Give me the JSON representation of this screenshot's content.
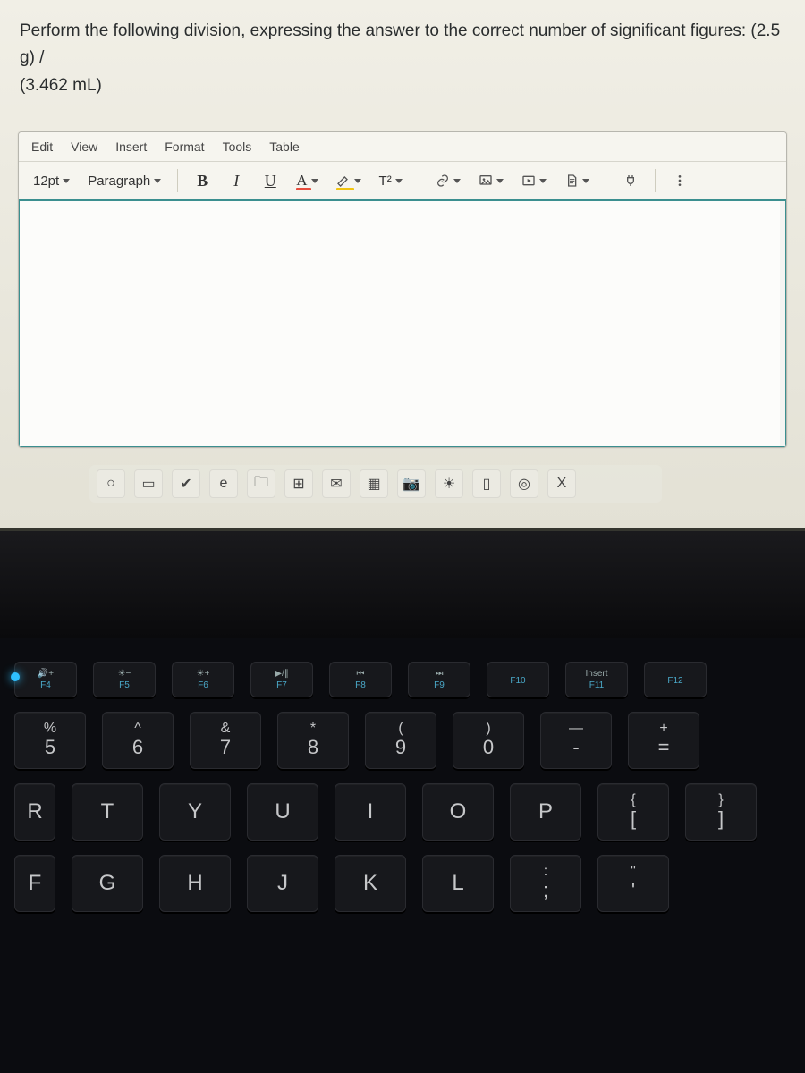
{
  "question": {
    "line1": "Perform the following division, expressing the answer to the correct number of significant figures: (2.5 g) /",
    "line2": "(3.462 mL)"
  },
  "menubar": {
    "edit": "Edit",
    "view": "View",
    "insert": "Insert",
    "format": "Format",
    "tools": "Tools",
    "table": "Table"
  },
  "toolbar": {
    "font_size": "12pt",
    "block": "Paragraph",
    "bold": "B",
    "italic": "I",
    "underline": "U",
    "textcolor": "A",
    "superscript": "T²"
  },
  "taskbar": {
    "items": [
      {
        "name": "search-icon",
        "glyph": "○"
      },
      {
        "name": "taskview-icon",
        "glyph": "▭"
      },
      {
        "name": "check-icon",
        "glyph": "✔"
      },
      {
        "name": "edge-icon",
        "glyph": "e"
      },
      {
        "name": "explorer-icon",
        "glyph": "🗀"
      },
      {
        "name": "store-icon",
        "glyph": "⊞"
      },
      {
        "name": "mail-icon",
        "glyph": "✉"
      },
      {
        "name": "photos-icon",
        "glyph": "▦"
      },
      {
        "name": "camera-icon",
        "glyph": "📷"
      },
      {
        "name": "weather-icon",
        "glyph": "☀"
      },
      {
        "name": "office-icon",
        "glyph": "▯"
      },
      {
        "name": "chrome-icon",
        "glyph": "◎"
      },
      {
        "name": "excel-icon",
        "glyph": "X"
      }
    ]
  },
  "keyboard": {
    "fn": [
      {
        "sym": "🔊+",
        "label": "F4"
      },
      {
        "sym": "☀−",
        "label": "F5"
      },
      {
        "sym": "☀+",
        "label": "F6"
      },
      {
        "sym": "▶/∥",
        "label": "F7"
      },
      {
        "sym": "⏮",
        "label": "F8"
      },
      {
        "sym": "⏭",
        "label": "F9"
      },
      {
        "sym": "",
        "label": "F10"
      },
      {
        "sym": "Insert",
        "label": "F11"
      },
      {
        "sym": "",
        "label": "F12"
      }
    ],
    "num": [
      {
        "upper": "%",
        "lower": "5"
      },
      {
        "upper": "^",
        "lower": "6"
      },
      {
        "upper": "&",
        "lower": "7"
      },
      {
        "upper": "*",
        "lower": "8"
      },
      {
        "upper": "(",
        "lower": "9"
      },
      {
        "upper": ")",
        "lower": "0"
      },
      {
        "upper": "—",
        "lower": "-"
      },
      {
        "upper": "+",
        "lower": "="
      }
    ],
    "qwerty": [
      {
        "l": "R",
        "half": true
      },
      {
        "l": "T"
      },
      {
        "l": "Y"
      },
      {
        "l": "U"
      },
      {
        "l": "I"
      },
      {
        "l": "O"
      },
      {
        "l": "P"
      },
      {
        "upper": "{",
        "lower": "["
      },
      {
        "upper": "}",
        "lower": "]"
      }
    ],
    "home": [
      {
        "l": "F",
        "half": true
      },
      {
        "l": "G"
      },
      {
        "l": "H"
      },
      {
        "l": "J"
      },
      {
        "l": "K"
      },
      {
        "l": "L"
      },
      {
        "upper": ":",
        "lower": ";"
      },
      {
        "upper": "\"",
        "lower": "'"
      }
    ]
  }
}
